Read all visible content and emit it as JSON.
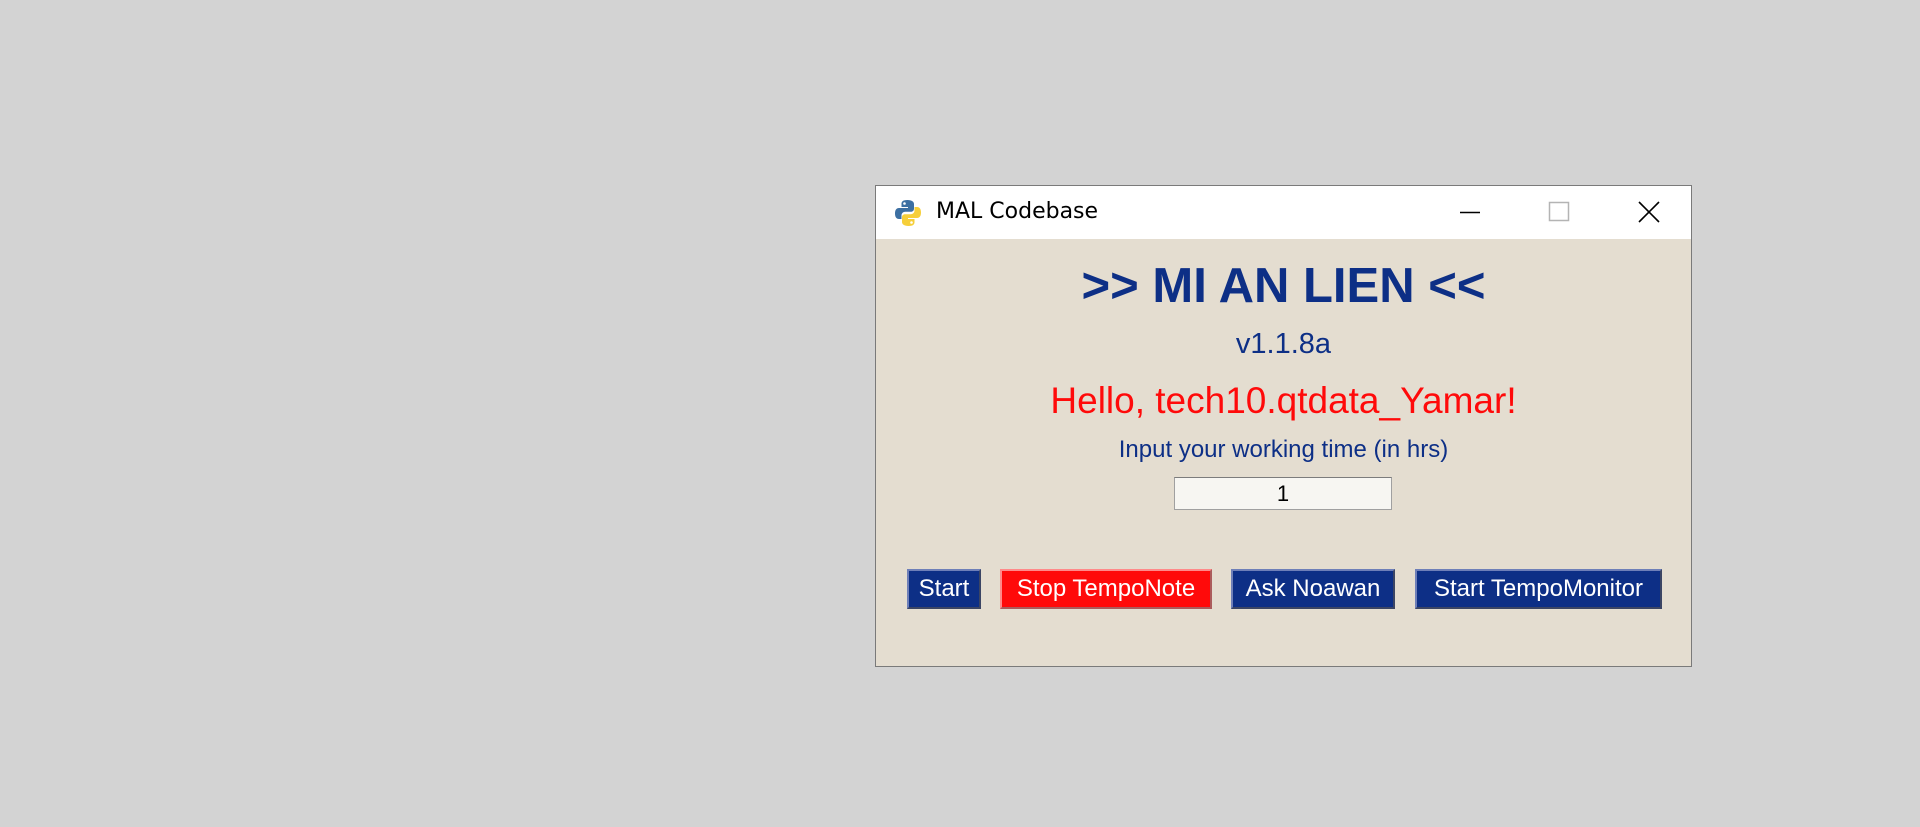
{
  "window": {
    "title": "MAL Codebase",
    "app_icon": "python-icon",
    "controls": {
      "minimize_icon": "minimize-icon",
      "maximize_icon": "maximize-icon",
      "close_icon": "close-icon"
    }
  },
  "content": {
    "heading": ">> MI AN LIEN <<",
    "version": "v1.1.8a",
    "greeting": "Hello, tech10.qtdata_Yamar!",
    "prompt_label": "Input your working time (in hrs)",
    "working_time_value": "1"
  },
  "buttons": {
    "start": "Start",
    "stop_temponote": "Stop TempoNote",
    "ask_noawan": "Ask Noawan",
    "start_tempomonitor": "Start TempoMonitor"
  },
  "colors": {
    "desktop_bg": "#d3d3d3",
    "window_bg": "#e4ddd0",
    "text_blue": "#0d2f86",
    "greeting_red": "#ff0a0a",
    "button_blue": "#0d2f86",
    "button_red": "#ff0a0a"
  }
}
